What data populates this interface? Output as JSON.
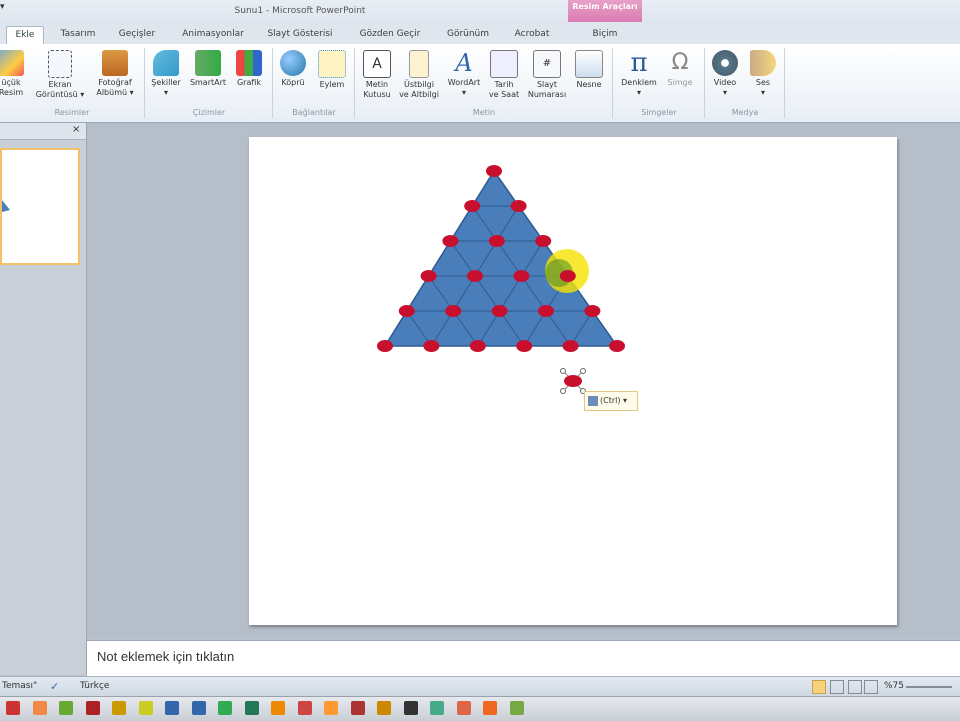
{
  "window": {
    "title": "Sunu1 - Microsoft PowerPoint",
    "context_label": "Resim Araçları",
    "context_tab": "Biçim"
  },
  "tabs": [
    "Ekle",
    "Tasarım",
    "Geçişler",
    "Animasyonlar",
    "Slayt Gösterisi",
    "Gözden Geçir",
    "Görünüm",
    "Acrobat"
  ],
  "ribbon": {
    "buttons": [
      {
        "l1": "üçük",
        "l2": "Resim"
      },
      {
        "l1": "Ekran",
        "l2": "Görüntüsü ▾"
      },
      {
        "l1": "Fotoğraf",
        "l2": "Albümü ▾"
      },
      {
        "l1": "Şekiller",
        "l2": "▾"
      },
      {
        "l1": "SmartArt",
        "l2": ""
      },
      {
        "l1": "Grafik",
        "l2": ""
      },
      {
        "l1": "Köprü",
        "l2": ""
      },
      {
        "l1": "Eylem",
        "l2": ""
      },
      {
        "l1": "Metin",
        "l2": "Kutusu"
      },
      {
        "l1": "Üstbilgi",
        "l2": "ve Altbilgi"
      },
      {
        "l1": "WordArt",
        "l2": "▾"
      },
      {
        "l1": "Tarih",
        "l2": "ve Saat"
      },
      {
        "l1": "Slayt",
        "l2": "Numarası"
      },
      {
        "l1": "Nesne",
        "l2": ""
      },
      {
        "l1": "Denklem",
        "l2": "▾"
      },
      {
        "l1": "Simge",
        "l2": ""
      },
      {
        "l1": "Video",
        "l2": "▾"
      },
      {
        "l1": "Ses",
        "l2": "▾"
      }
    ],
    "groups": [
      "Resimler",
      "Çizimler",
      "Bağlantılar",
      "Metin",
      "Simgeler",
      "Medya"
    ]
  },
  "paste_options": {
    "label": "(Ctrl) ▾"
  },
  "notes": {
    "placeholder": "Not eklemek için tıklatın"
  },
  "status": {
    "theme": "Teması\"",
    "language": "Türkçe",
    "zoom": "%75"
  },
  "colors": {
    "triangle_fill": "#4a7ebb",
    "node_fill": "#c8102e",
    "highlight": "#f5e400"
  }
}
